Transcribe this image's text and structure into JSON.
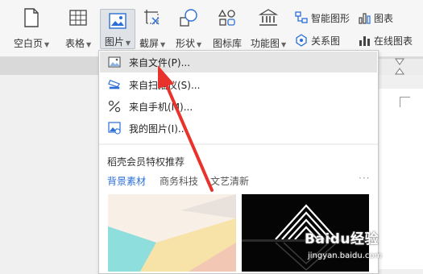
{
  "ribbon": {
    "blank_page": "空白页",
    "table": "表格",
    "picture": "图片",
    "screenshot": "截屏",
    "shapes": "形状",
    "icon_library": "图标库",
    "function_chart": "功能图",
    "smart_graphic": "智能图形",
    "chart": "图表",
    "relation_chart": "关系图",
    "online_chart": "在线图表"
  },
  "dropdown": {
    "items": [
      {
        "label": "来自文件(P)...",
        "icon": "image-icon"
      },
      {
        "label": "来自扫描仪(S)...",
        "icon": "scanner-icon"
      },
      {
        "label": "来自手机(M)...",
        "icon": "phone-icon"
      },
      {
        "label": "我的图片(I)...",
        "icon": "my-pictures-icon"
      }
    ],
    "section_title": "稻壳会员特权推荐",
    "tabs": [
      "背景素材",
      "商务科技",
      "文艺清新"
    ],
    "more": "···"
  },
  "watermark": {
    "brand": "Baidu经验",
    "url": "jingyan.baidu.com"
  },
  "colors": {
    "accent": "#2b6fd6",
    "arrow": "#e8322b",
    "icon_blue": "#2b6fd6"
  }
}
